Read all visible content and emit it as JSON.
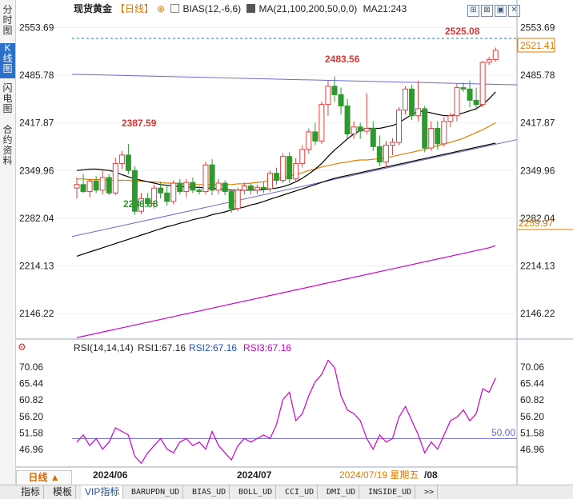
{
  "side_tabs": [
    "分时图",
    "K线图",
    "闪电图",
    "合约资料"
  ],
  "header": {
    "symbol": "现货黄金",
    "period": "【日线】",
    "plus_icon": "⊕",
    "bias_label": "BIAS(12,-6,6)",
    "ma_label": "MA(21,100,200,50,0,0)",
    "ma21_label": "MA21:243"
  },
  "window_buttons": [
    "restore-icon",
    "maximize-icon",
    "fullscreen-icon",
    "close-icon"
  ],
  "price_axis": {
    "ticks": [
      "2553.69",
      "2485.78",
      "2417.87",
      "2349.96",
      "2282.04",
      "2214.13",
      "2146.22"
    ],
    "current_price": "2521.41",
    "ma_value": "2259.97"
  },
  "annotations": {
    "high": "2525.08",
    "mid_high": "2483.56",
    "left_high": "2387.59",
    "low": "2286.68"
  },
  "rsi": {
    "label": "RSI(14,14,14)",
    "rsi1": "RSI1:67.16",
    "rsi2": "RSI2:67.16",
    "rsi3": "RSI3:67.16",
    "ticks": [
      "70.06",
      "65.44",
      "60.82",
      "56.20",
      "51.58",
      "46.96"
    ],
    "ref_value": "50.00"
  },
  "date_axis": {
    "labels": [
      "2024/06",
      "2024/07",
      "/08"
    ],
    "cursor_date": "2024/07/19 星期五"
  },
  "period_button": "日线 ▲",
  "bottom_tabs": [
    "指标",
    "模板",
    "VIP指标",
    "BARUPDN_UD",
    "BIAS_UD",
    "BOLL_UD",
    "CCI_UD",
    "DMI_UD",
    "INSIDE_UD",
    ">>"
  ],
  "colors": {
    "up": "#e04040",
    "down": "#2e9a2e",
    "ma21": "#000000",
    "ma50": "#e08000",
    "ma100": "#000000",
    "ma200": "#cc00cc",
    "trendline": "#6a6ad0",
    "rsi": "#cc00cc",
    "rsi_ref": "#6a6ad0",
    "current_price": "#e07a00"
  },
  "chart_data": {
    "type": "candlestick",
    "y_range": [
      2110,
      2570
    ],
    "candles": [
      {
        "o": 2325,
        "h": 2340,
        "l": 2310,
        "c": 2330
      },
      {
        "o": 2330,
        "h": 2345,
        "l": 2318,
        "c": 2320
      },
      {
        "o": 2320,
        "h": 2338,
        "l": 2312,
        "c": 2335
      },
      {
        "o": 2335,
        "h": 2342,
        "l": 2318,
        "c": 2322
      },
      {
        "o": 2322,
        "h": 2350,
        "l": 2316,
        "c": 2340
      },
      {
        "o": 2340,
        "h": 2345,
        "l": 2315,
        "c": 2318
      },
      {
        "o": 2318,
        "h": 2368,
        "l": 2315,
        "c": 2360
      },
      {
        "o": 2360,
        "h": 2378,
        "l": 2352,
        "c": 2372
      },
      {
        "o": 2372,
        "h": 2388,
        "l": 2345,
        "c": 2350
      },
      {
        "o": 2350,
        "h": 2356,
        "l": 2287,
        "c": 2292
      },
      {
        "o": 2292,
        "h": 2318,
        "l": 2288,
        "c": 2310
      },
      {
        "o": 2310,
        "h": 2318,
        "l": 2298,
        "c": 2303
      },
      {
        "o": 2303,
        "h": 2330,
        "l": 2296,
        "c": 2325
      },
      {
        "o": 2325,
        "h": 2334,
        "l": 2310,
        "c": 2318
      },
      {
        "o": 2318,
        "h": 2330,
        "l": 2300,
        "c": 2306
      },
      {
        "o": 2306,
        "h": 2336,
        "l": 2302,
        "c": 2332
      },
      {
        "o": 2332,
        "h": 2338,
        "l": 2316,
        "c": 2320
      },
      {
        "o": 2320,
        "h": 2338,
        "l": 2312,
        "c": 2333
      },
      {
        "o": 2333,
        "h": 2340,
        "l": 2318,
        "c": 2322
      },
      {
        "o": 2322,
        "h": 2328,
        "l": 2316,
        "c": 2320
      },
      {
        "o": 2320,
        "h": 2362,
        "l": 2316,
        "c": 2358
      },
      {
        "o": 2358,
        "h": 2366,
        "l": 2315,
        "c": 2322
      },
      {
        "o": 2322,
        "h": 2338,
        "l": 2316,
        "c": 2332
      },
      {
        "o": 2332,
        "h": 2336,
        "l": 2315,
        "c": 2320
      },
      {
        "o": 2320,
        "h": 2322,
        "l": 2290,
        "c": 2296
      },
      {
        "o": 2296,
        "h": 2326,
        "l": 2292,
        "c": 2322
      },
      {
        "o": 2322,
        "h": 2333,
        "l": 2316,
        "c": 2328
      },
      {
        "o": 2328,
        "h": 2332,
        "l": 2316,
        "c": 2322
      },
      {
        "o": 2322,
        "h": 2330,
        "l": 2316,
        "c": 2326
      },
      {
        "o": 2326,
        "h": 2334,
        "l": 2318,
        "c": 2324
      },
      {
        "o": 2324,
        "h": 2350,
        "l": 2320,
        "c": 2346
      },
      {
        "o": 2346,
        "h": 2354,
        "l": 2330,
        "c": 2336
      },
      {
        "o": 2336,
        "h": 2375,
        "l": 2332,
        "c": 2370
      },
      {
        "o": 2370,
        "h": 2376,
        "l": 2332,
        "c": 2338
      },
      {
        "o": 2338,
        "h": 2368,
        "l": 2334,
        "c": 2360
      },
      {
        "o": 2360,
        "h": 2386,
        "l": 2354,
        "c": 2380
      },
      {
        "o": 2380,
        "h": 2410,
        "l": 2374,
        "c": 2405
      },
      {
        "o": 2405,
        "h": 2418,
        "l": 2386,
        "c": 2392
      },
      {
        "o": 2392,
        "h": 2448,
        "l": 2388,
        "c": 2444
      },
      {
        "o": 2444,
        "h": 2478,
        "l": 2428,
        "c": 2470
      },
      {
        "o": 2470,
        "h": 2484,
        "l": 2448,
        "c": 2458
      },
      {
        "o": 2458,
        "h": 2468,
        "l": 2430,
        "c": 2442
      },
      {
        "o": 2442,
        "h": 2452,
        "l": 2396,
        "c": 2402
      },
      {
        "o": 2402,
        "h": 2420,
        "l": 2395,
        "c": 2412
      },
      {
        "o": 2412,
        "h": 2418,
        "l": 2395,
        "c": 2406
      },
      {
        "o": 2406,
        "h": 2460,
        "l": 2402,
        "c": 2410
      },
      {
        "o": 2410,
        "h": 2420,
        "l": 2378,
        "c": 2384
      },
      {
        "o": 2384,
        "h": 2400,
        "l": 2356,
        "c": 2362
      },
      {
        "o": 2362,
        "h": 2392,
        "l": 2355,
        "c": 2386
      },
      {
        "o": 2386,
        "h": 2396,
        "l": 2372,
        "c": 2390
      },
      {
        "o": 2390,
        "h": 2440,
        "l": 2386,
        "c": 2436
      },
      {
        "o": 2436,
        "h": 2470,
        "l": 2430,
        "c": 2466
      },
      {
        "o": 2466,
        "h": 2472,
        "l": 2422,
        "c": 2428
      },
      {
        "o": 2428,
        "h": 2478,
        "l": 2420,
        "c": 2438
      },
      {
        "o": 2438,
        "h": 2442,
        "l": 2376,
        "c": 2382
      },
      {
        "o": 2382,
        "h": 2420,
        "l": 2378,
        "c": 2410
      },
      {
        "o": 2410,
        "h": 2420,
        "l": 2380,
        "c": 2388
      },
      {
        "o": 2388,
        "h": 2426,
        "l": 2384,
        "c": 2420
      },
      {
        "o": 2420,
        "h": 2432,
        "l": 2412,
        "c": 2428
      },
      {
        "o": 2428,
        "h": 2474,
        "l": 2420,
        "c": 2468
      },
      {
        "o": 2468,
        "h": 2475,
        "l": 2462,
        "c": 2466
      },
      {
        "o": 2466,
        "h": 2478,
        "l": 2440,
        "c": 2450
      },
      {
        "o": 2450,
        "h": 2468,
        "l": 2436,
        "c": 2444
      },
      {
        "o": 2444,
        "h": 2506,
        "l": 2440,
        "c": 2504
      },
      {
        "o": 2504,
        "h": 2512,
        "l": 2500,
        "c": 2508
      },
      {
        "o": 2508,
        "h": 2525,
        "l": 2505,
        "c": 2521
      }
    ],
    "ma21": [
      2350,
      2351,
      2352,
      2352,
      2351,
      2350,
      2348,
      2344,
      2341,
      2338,
      2336,
      2334,
      2332,
      2330,
      2329,
      2328,
      2327,
      2327,
      2326,
      2326,
      2325,
      2325,
      2324,
      2323,
      2322,
      2322,
      2322,
      2322,
      2322,
      2323,
      2324,
      2325,
      2327,
      2330,
      2334,
      2339,
      2345,
      2352,
      2360,
      2370,
      2379,
      2387,
      2395,
      2402,
      2407,
      2410,
      2410,
      2410,
      2412,
      2414,
      2418,
      2424,
      2430,
      2434,
      2434,
      2432,
      2430,
      2428,
      2428,
      2430,
      2432,
      2435,
      2438,
      2444,
      2452,
      2462
    ],
    "ma50": [
      2338,
      2338,
      2337,
      2337,
      2337,
      2336,
      2336,
      2336,
      2336,
      2335,
      2335,
      2334,
      2334,
      2333,
      2332,
      2332,
      2331,
      2331,
      2330,
      2330,
      2330,
      2330,
      2330,
      2330,
      2330,
      2331,
      2331,
      2332,
      2333,
      2334,
      2336,
      2338,
      2340,
      2342,
      2344,
      2347,
      2350,
      2352,
      2355,
      2357,
      2359,
      2361,
      2362,
      2364,
      2365,
      2365,
      2366,
      2367,
      2368,
      2370,
      2372,
      2374,
      2376,
      2378,
      2380,
      2383,
      2385,
      2388,
      2390,
      2393,
      2396,
      2400,
      2404,
      2408,
      2413,
      2418
    ],
    "ma100": [
      2228,
      2231,
      2234,
      2237,
      2240,
      2243,
      2246,
      2249,
      2252,
      2255,
      2258,
      2261,
      2264,
      2267,
      2270,
      2272,
      2275,
      2277,
      2280,
      2282,
      2284,
      2287,
      2289,
      2291,
      2294,
      2296,
      2298,
      2301,
      2303,
      2306,
      2309,
      2312,
      2315,
      2318,
      2321,
      2324,
      2327,
      2330,
      2333,
      2336,
      2339,
      2341,
      2343,
      2345,
      2347,
      2349,
      2351,
      2353,
      2355,
      2357,
      2359,
      2361,
      2363,
      2365,
      2367,
      2369,
      2371,
      2373,
      2375,
      2377,
      2379,
      2381,
      2383,
      2385,
      2387,
      2389
    ],
    "ma200": [
      2112,
      2114,
      2116,
      2118,
      2120,
      2122,
      2124,
      2126,
      2128,
      2130,
      2132,
      2134,
      2136,
      2138,
      2140,
      2142,
      2144,
      2146,
      2148,
      2150,
      2152,
      2154,
      2156,
      2158,
      2160,
      2162,
      2164,
      2166,
      2168,
      2170,
      2172,
      2174,
      2176,
      2178,
      2180,
      2182,
      2184,
      2186,
      2188,
      2190,
      2192,
      2194,
      2196,
      2198,
      2200,
      2202,
      2204,
      2206,
      2208,
      2210,
      2212,
      2214,
      2216,
      2218,
      2220,
      2222,
      2224,
      2226,
      2228,
      2230,
      2232,
      2234,
      2236,
      2238,
      2240,
      2243
    ],
    "trend_upper": {
      "from": [
        0,
        2487
      ],
      "to": [
        79,
        2472
      ]
    },
    "trend_lower": {
      "from": [
        0,
        2256
      ],
      "to": [
        79,
        2394
      ]
    },
    "rsi_range": [
      42,
      73
    ],
    "rsi_values": [
      49,
      51,
      48,
      50,
      47,
      49,
      53,
      52,
      51,
      45,
      43,
      46,
      48,
      50,
      47,
      46,
      49,
      50,
      48,
      49,
      47,
      52,
      48,
      46,
      44,
      48,
      50,
      49,
      50,
      51,
      50,
      54,
      61,
      63,
      55,
      57,
      62,
      66,
      68,
      72,
      70,
      62,
      58,
      57,
      55,
      50,
      47,
      51,
      49,
      50,
      56,
      59,
      55,
      51,
      46,
      49,
      47,
      51,
      55,
      56,
      58,
      55,
      57,
      64,
      63,
      67
    ],
    "rsi_ref": 50
  }
}
